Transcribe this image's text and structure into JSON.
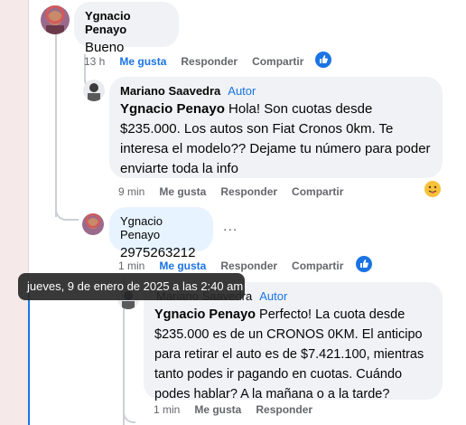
{
  "comments": [
    {
      "author": "Ygnacio Penayo",
      "text": "Bueno",
      "time": "13 h",
      "like": "Me gusta",
      "reply": "Responder",
      "share": "Compartir"
    },
    {
      "author": "Mariano Saavedra",
      "badge": "Autor",
      "mention": "Ygnacio Penayo",
      "text": " Hola! Son cuotas desde $235.000. Los autos son Fiat Cronos 0km. Te interesa el modelo?? Dejame tu número para poder enviarte toda la info",
      "time": "9 min",
      "like": "Me gusta",
      "reply": "Responder",
      "share": "Compartir"
    },
    {
      "author": "Ygnacio Penayo",
      "text": "2975263212",
      "more": "...",
      "time": "1 min",
      "like": "Me gusta",
      "reply": "Responder",
      "share": "Compartir"
    },
    {
      "author": "Mariano Saavedra",
      "badge": "Autor",
      "mention": "Ygnacio Penayo",
      "text": " Perfecto! La cuota desde $235.000 es de un CRONOS 0KM. El anticipo para retirar el auto es de $7.421.100, mientras tanto podes ir pagando en cuotas. Cuándo podes hablar? A la mañana o a la tarde?",
      "time": "1 min",
      "like": "Me gusta",
      "reply": "Responder"
    }
  ],
  "tooltip": "jueves, 9 de enero de 2025 a las 2:40 am",
  "colors": {
    "accent": "#1b74e4",
    "bubble": "#f0f2f5",
    "bubble_highlight": "#e7f3ff",
    "muted": "#65676b"
  },
  "icons": [
    "like-reaction-icon",
    "tongue-face-reaction-icon",
    "more-options-icon"
  ]
}
